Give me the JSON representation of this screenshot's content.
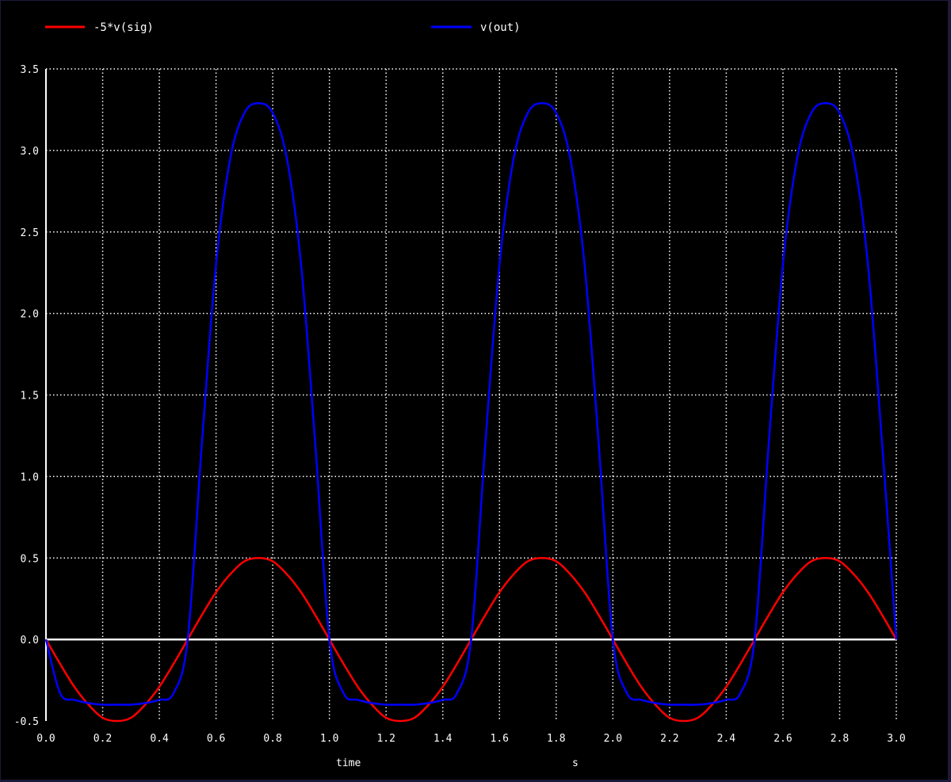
{
  "colors": {
    "background": "#000000",
    "window_border": "#1a1a3a",
    "grid": "#ffffff",
    "axes": "#ffffff",
    "series_sig": "#ff0000",
    "series_out": "#0000ff"
  },
  "legend": [
    {
      "label": "-5*v(sig)",
      "color": "#ff0000"
    },
    {
      "label": "v(out)",
      "color": "#0000ff"
    }
  ],
  "chart_data": {
    "type": "line",
    "xlabel": "time",
    "xunit": "s",
    "ylabel": "",
    "xlim": [
      0.0,
      3.0
    ],
    "ylim": [
      -0.5,
      3.5
    ],
    "grid": true,
    "legend_position": "top",
    "x_ticks": [
      "0.0",
      "0.2",
      "0.4",
      "0.6",
      "0.8",
      "1.0",
      "1.2",
      "1.4",
      "1.6",
      "1.8",
      "2.0",
      "2.2",
      "2.4",
      "2.6",
      "2.8",
      "3.0"
    ],
    "y_ticks": [
      "-0.5",
      "0.0",
      "0.5",
      "1.0",
      "1.5",
      "2.0",
      "2.5",
      "3.0",
      "3.5"
    ],
    "x": [
      0.0,
      0.05,
      0.1,
      0.15,
      0.2,
      0.25,
      0.3,
      0.35,
      0.4,
      0.45,
      0.5,
      0.55,
      0.6,
      0.65,
      0.7,
      0.75,
      0.8,
      0.85,
      0.9,
      0.95,
      1.0,
      1.05,
      1.1,
      1.15,
      1.2,
      1.25,
      1.3,
      1.35,
      1.4,
      1.45,
      1.5,
      1.55,
      1.6,
      1.65,
      1.7,
      1.75,
      1.8,
      1.85,
      1.9,
      1.95,
      2.0,
      2.05,
      2.1,
      2.15,
      2.2,
      2.25,
      2.3,
      2.35,
      2.4,
      2.45,
      2.5,
      2.55,
      2.6,
      2.65,
      2.7,
      2.75,
      2.8,
      2.85,
      2.9,
      2.95,
      3.0
    ],
    "series": [
      {
        "name": "-5*v(sig)",
        "color": "#ff0000",
        "values": [
          0.0,
          -0.15,
          -0.29,
          -0.4,
          -0.48,
          -0.5,
          -0.48,
          -0.4,
          -0.29,
          -0.15,
          0.0,
          0.15,
          0.29,
          0.4,
          0.48,
          0.5,
          0.48,
          0.4,
          0.29,
          0.15,
          0.0,
          -0.15,
          -0.29,
          -0.4,
          -0.48,
          -0.5,
          -0.48,
          -0.4,
          -0.29,
          -0.15,
          0.0,
          0.15,
          0.29,
          0.4,
          0.48,
          0.5,
          0.48,
          0.4,
          0.29,
          0.15,
          0.0,
          -0.15,
          -0.29,
          -0.4,
          -0.48,
          -0.5,
          -0.48,
          -0.4,
          -0.29,
          -0.15,
          0.0,
          0.15,
          0.29,
          0.4,
          0.48,
          0.5,
          0.48,
          0.4,
          0.29,
          0.15,
          0.0
        ]
      },
      {
        "name": "v(out)",
        "color": "#0000ff",
        "values": [
          0.0,
          -0.33,
          -0.37,
          -0.39,
          -0.4,
          -0.4,
          -0.4,
          -0.39,
          -0.37,
          -0.33,
          0.0,
          1.2,
          2.3,
          2.95,
          3.23,
          3.29,
          3.23,
          2.95,
          2.3,
          1.2,
          0.0,
          -0.33,
          -0.37,
          -0.39,
          -0.4,
          -0.4,
          -0.4,
          -0.39,
          -0.37,
          -0.33,
          0.0,
          1.2,
          2.3,
          2.95,
          3.23,
          3.29,
          3.23,
          2.95,
          2.3,
          1.2,
          0.0,
          -0.33,
          -0.37,
          -0.39,
          -0.4,
          -0.4,
          -0.4,
          -0.39,
          -0.37,
          -0.33,
          0.0,
          1.2,
          2.3,
          2.95,
          3.23,
          3.29,
          3.23,
          2.95,
          2.3,
          1.2,
          0.0
        ]
      }
    ]
  }
}
